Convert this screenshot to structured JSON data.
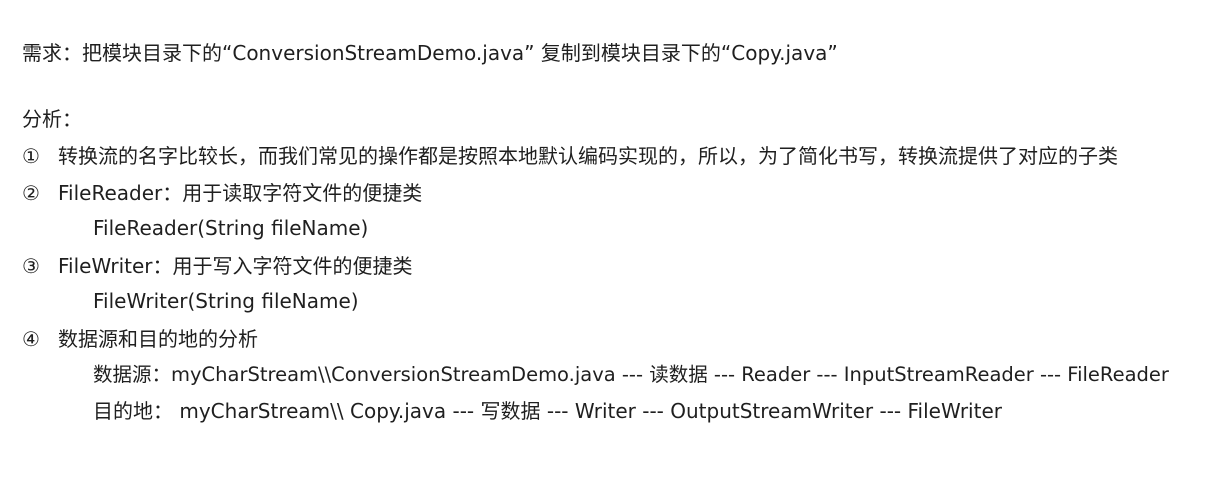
{
  "requirement": "需求：把模块目录下的“ConversionStreamDemo.java” 复制到模块目录下的“Copy.java”",
  "analysis_heading": "分析：",
  "items": [
    {
      "marker": "①",
      "text": "转换流的名字比较长，而我们常见的操作都是按照本地默认编码实现的，所以，为了简化书写，转换流提供了对应的子类"
    },
    {
      "marker": "②",
      "text": "FileReader：用于读取字符文件的便捷类",
      "detail": "FileReader(String fileName)"
    },
    {
      "marker": "③",
      "text": "FileWriter：用于写入字符文件的便捷类",
      "detail": "FileWriter(String fileName)"
    },
    {
      "marker": "④",
      "text": "数据源和目的地的分析",
      "source_line": "数据源：myCharStream\\\\ConversionStreamDemo.java --- 读数据 --- Reader --- InputStreamReader --- FileReader",
      "destination_line": "目的地： myCharStream\\\\ Copy.java --- 写数据 --- Writer --- OutputStreamWriter --- FileWriter"
    }
  ]
}
